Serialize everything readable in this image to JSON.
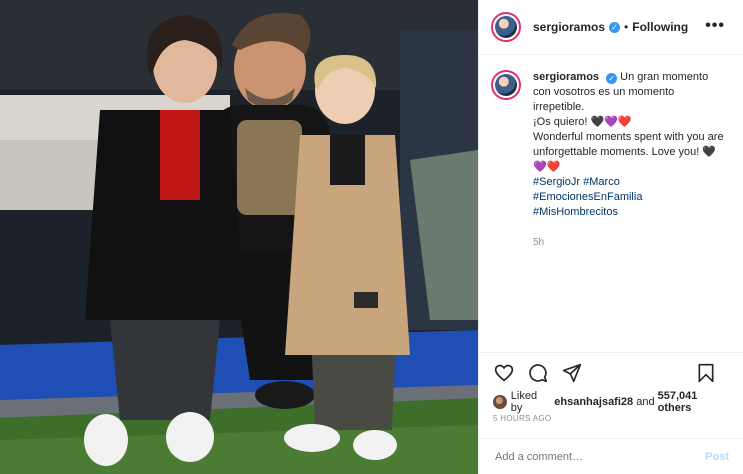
{
  "post": {
    "image_alt": "",
    "header": {
      "username": "sergioramos",
      "separator": "•",
      "follow_status": "Following",
      "more": "•••"
    },
    "caption": {
      "username": "sergioramos",
      "lines": [
        "Un gran momento con vosotros es un momento irrepetible.",
        "¡Os quiero! 🖤💜❤️",
        "Wonderful moments spent with you are unforgettable moments. Love you! 🖤💜❤️"
      ],
      "hashtags": [
        "#SergioJr #Marco",
        "#EmocionesEnFamilia",
        "#MisHombrecitos"
      ],
      "time": "5h"
    },
    "likes": {
      "liked_by_prefix": "Liked by",
      "liked_by_user": "ehsanhajsafi28",
      "and_text": "and",
      "others_count": "557,041 others"
    },
    "date": "5 HOURS AGO",
    "comment": {
      "placeholder": "Add a comment…",
      "post_label": "Post"
    }
  },
  "icons": [
    "heart-icon",
    "comment-icon",
    "share-icon",
    "bookmark-icon",
    "verified-icon"
  ],
  "colors": {
    "verified": "#3897f0",
    "hashtag": "#003569",
    "post_disabled": "#b3dbff",
    "muted": "#8e8e8e",
    "story_ring": "#e1306c"
  }
}
